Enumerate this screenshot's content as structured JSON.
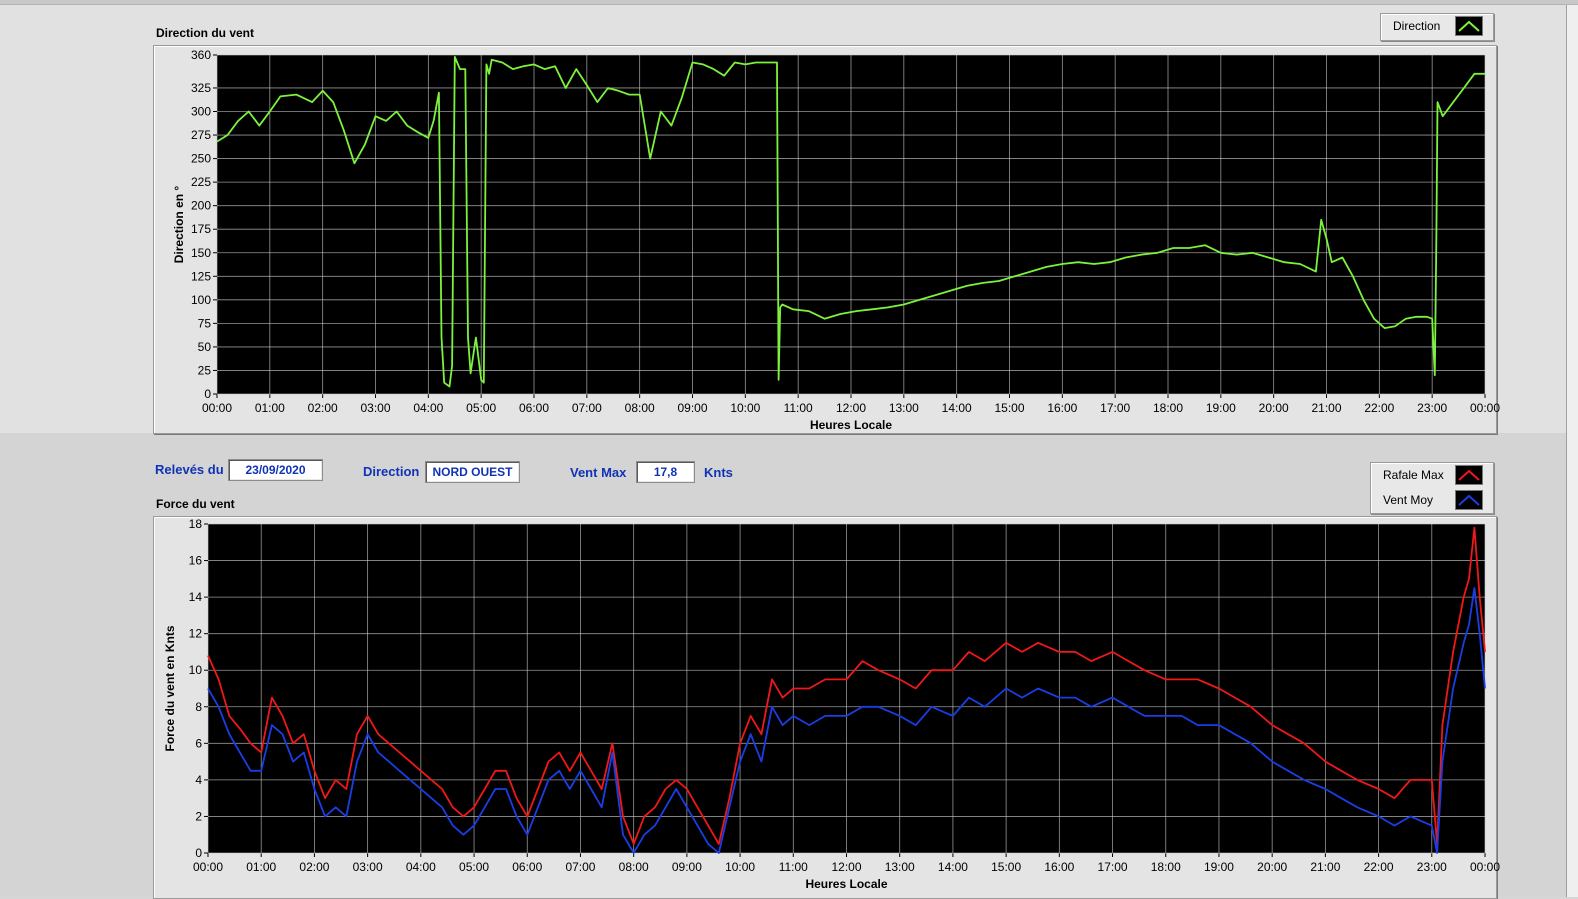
{
  "header": {
    "releves_label": "Relevés du",
    "releves_value": "23/09/2020",
    "direction_label": "Direction",
    "direction_value": "NORD OUEST",
    "ventmax_label": "Vent Max",
    "ventmax_value": "17,8",
    "ventmax_unit": "Knts"
  },
  "colors": {
    "direction_line": "#7cf23c",
    "rafale_line": "#f01818",
    "vent_line": "#1a3ee6",
    "plot_bg": "#000000",
    "grid": "#c8c8c8",
    "label_blue": "#1033b5"
  },
  "chart_data": [
    {
      "type": "line",
      "title": "Direction du vent",
      "xlabel": "Heures Locale",
      "ylabel": "Direction en °",
      "xlim": [
        0,
        24
      ],
      "ylim": [
        0,
        360
      ],
      "yticks": [
        0,
        25,
        50,
        75,
        100,
        125,
        150,
        175,
        200,
        225,
        250,
        275,
        300,
        325,
        360
      ],
      "xtick_labels": [
        "00:00",
        "01:00",
        "02:00",
        "03:00",
        "04:00",
        "05:00",
        "06:00",
        "07:00",
        "08:00",
        "09:00",
        "10:00",
        "11:00",
        "12:00",
        "13:00",
        "14:00",
        "15:00",
        "16:00",
        "17:00",
        "18:00",
        "19:00",
        "20:00",
        "21:00",
        "22:00",
        "23:00",
        "00:00"
      ],
      "grid": true,
      "legend_position": "top-right",
      "series": [
        {
          "name": "Direction",
          "color": "#7cf23c",
          "x": [
            0,
            0.2,
            0.4,
            0.6,
            0.8,
            1.0,
            1.2,
            1.5,
            1.8,
            2.0,
            2.2,
            2.4,
            2.6,
            2.8,
            3.0,
            3.2,
            3.4,
            3.6,
            3.8,
            4.0,
            4.1,
            4.2,
            4.25,
            4.3,
            4.4,
            4.45,
            4.5,
            4.6,
            4.7,
            4.75,
            4.8,
            4.9,
            5.0,
            5.05,
            5.1,
            5.15,
            5.2,
            5.4,
            5.6,
            5.8,
            6.0,
            6.2,
            6.4,
            6.6,
            6.8,
            7.0,
            7.2,
            7.4,
            7.6,
            7.8,
            8.0,
            8.2,
            8.4,
            8.6,
            8.8,
            9.0,
            9.2,
            9.4,
            9.6,
            9.8,
            10.0,
            10.2,
            10.4,
            10.6,
            10.63,
            10.66,
            10.7,
            10.9,
            11.2,
            11.5,
            11.8,
            12.1,
            12.4,
            12.7,
            13.0,
            13.3,
            13.6,
            13.9,
            14.2,
            14.5,
            14.8,
            15.1,
            15.4,
            15.7,
            16.0,
            16.3,
            16.6,
            16.9,
            17.2,
            17.5,
            17.8,
            18.1,
            18.4,
            18.7,
            19.0,
            19.3,
            19.6,
            19.9,
            20.2,
            20.5,
            20.8,
            20.9,
            21.0,
            21.1,
            21.3,
            21.5,
            21.7,
            21.9,
            22.1,
            22.3,
            22.5,
            22.7,
            22.9,
            23.0,
            23.05,
            23.08,
            23.1,
            23.2,
            23.4,
            23.6,
            23.8,
            24.0
          ],
          "y": [
            268,
            275,
            290,
            300,
            285,
            300,
            316,
            318,
            310,
            322,
            310,
            280,
            245,
            265,
            295,
            290,
            300,
            285,
            278,
            272,
            290,
            320,
            60,
            12,
            8,
            30,
            358,
            345,
            345,
            60,
            22,
            60,
            15,
            12,
            350,
            340,
            355,
            352,
            345,
            348,
            350,
            345,
            348,
            325,
            345,
            328,
            310,
            325,
            322,
            318,
            318,
            250,
            300,
            285,
            315,
            352,
            350,
            345,
            338,
            352,
            350,
            352,
            352,
            352,
            15,
            92,
            95,
            90,
            88,
            80,
            85,
            88,
            90,
            92,
            95,
            100,
            105,
            110,
            115,
            118,
            120,
            125,
            130,
            135,
            138,
            140,
            138,
            140,
            145,
            148,
            150,
            155,
            155,
            158,
            150,
            148,
            150,
            145,
            140,
            138,
            130,
            185,
            165,
            140,
            145,
            125,
            100,
            80,
            70,
            72,
            80,
            82,
            82,
            80,
            20,
            170,
            310,
            295,
            310,
            325,
            340,
            340
          ]
        }
      ]
    },
    {
      "type": "line",
      "title": "Force du vent",
      "xlabel": "Heures Locale",
      "ylabel": "Force du vent en Knts",
      "xlim": [
        0,
        24
      ],
      "ylim": [
        0,
        18
      ],
      "yticks": [
        0,
        2,
        4,
        6,
        8,
        10,
        12,
        14,
        16,
        18
      ],
      "xtick_labels": [
        "00:00",
        "01:00",
        "02:00",
        "03:00",
        "04:00",
        "05:00",
        "06:00",
        "07:00",
        "08:00",
        "09:00",
        "10:00",
        "11:00",
        "12:00",
        "13:00",
        "14:00",
        "15:00",
        "16:00",
        "17:00",
        "18:00",
        "19:00",
        "20:00",
        "21:00",
        "22:00",
        "23:00",
        "00:00"
      ],
      "grid": true,
      "legend_position": "top-right",
      "series": [
        {
          "name": "Rafale Max",
          "color": "#f01818",
          "x": [
            0,
            0.2,
            0.4,
            0.6,
            0.8,
            1.0,
            1.2,
            1.4,
            1.6,
            1.8,
            2.0,
            2.2,
            2.4,
            2.6,
            2.8,
            3.0,
            3.2,
            3.4,
            3.6,
            3.8,
            4.0,
            4.2,
            4.4,
            4.6,
            4.8,
            5.0,
            5.2,
            5.4,
            5.6,
            5.8,
            6.0,
            6.2,
            6.4,
            6.6,
            6.8,
            7.0,
            7.2,
            7.4,
            7.6,
            7.8,
            8.0,
            8.2,
            8.4,
            8.6,
            8.8,
            9.0,
            9.2,
            9.4,
            9.6,
            9.8,
            10.0,
            10.2,
            10.4,
            10.6,
            10.8,
            11.0,
            11.3,
            11.6,
            12.0,
            12.3,
            12.6,
            13.0,
            13.3,
            13.6,
            14.0,
            14.3,
            14.6,
            15.0,
            15.3,
            15.6,
            16.0,
            16.3,
            16.6,
            17.0,
            17.3,
            17.6,
            18.0,
            18.3,
            18.6,
            19.0,
            19.3,
            19.6,
            20.0,
            20.3,
            20.6,
            21.0,
            21.3,
            21.6,
            22.0,
            22.3,
            22.6,
            23.0,
            23.1,
            23.2,
            23.4,
            23.6,
            23.7,
            23.8,
            23.9,
            24.0
          ],
          "y": [
            10.8,
            9.5,
            7.5,
            6.8,
            6.0,
            5.5,
            8.5,
            7.5,
            6.0,
            6.5,
            4.5,
            3.0,
            4.0,
            3.5,
            6.5,
            7.5,
            6.5,
            6.0,
            5.5,
            5.0,
            4.5,
            4.0,
            3.5,
            2.5,
            2.0,
            2.5,
            3.5,
            4.5,
            4.5,
            3.0,
            2.0,
            3.5,
            5.0,
            5.5,
            4.5,
            5.5,
            4.5,
            3.5,
            6.0,
            2.0,
            0.5,
            2.0,
            2.5,
            3.5,
            4.0,
            3.5,
            2.5,
            1.5,
            0.5,
            3.0,
            6.0,
            7.5,
            6.5,
            9.5,
            8.5,
            9.0,
            9.0,
            9.5,
            9.5,
            10.5,
            10.0,
            9.5,
            9.0,
            10.0,
            10.0,
            11.0,
            10.5,
            11.5,
            11.0,
            11.5,
            11.0,
            11.0,
            10.5,
            11.0,
            10.5,
            10.0,
            9.5,
            9.5,
            9.5,
            9.0,
            8.5,
            8.0,
            7.0,
            6.5,
            6.0,
            5.0,
            4.5,
            4.0,
            3.5,
            3.0,
            4.0,
            4.0,
            0.5,
            7.0,
            11.0,
            14.0,
            15.0,
            17.8,
            14.0,
            11.0
          ]
        },
        {
          "name": "Vent Moy",
          "color": "#1a3ee6",
          "x": [
            0,
            0.2,
            0.4,
            0.6,
            0.8,
            1.0,
            1.2,
            1.4,
            1.6,
            1.8,
            2.0,
            2.2,
            2.4,
            2.6,
            2.8,
            3.0,
            3.2,
            3.4,
            3.6,
            3.8,
            4.0,
            4.2,
            4.4,
            4.6,
            4.8,
            5.0,
            5.2,
            5.4,
            5.6,
            5.8,
            6.0,
            6.2,
            6.4,
            6.6,
            6.8,
            7.0,
            7.2,
            7.4,
            7.6,
            7.8,
            8.0,
            8.2,
            8.4,
            8.6,
            8.8,
            9.0,
            9.2,
            9.4,
            9.6,
            9.8,
            10.0,
            10.2,
            10.4,
            10.6,
            10.8,
            11.0,
            11.3,
            11.6,
            12.0,
            12.3,
            12.6,
            13.0,
            13.3,
            13.6,
            14.0,
            14.3,
            14.6,
            15.0,
            15.3,
            15.6,
            16.0,
            16.3,
            16.6,
            17.0,
            17.3,
            17.6,
            18.0,
            18.3,
            18.6,
            19.0,
            19.3,
            19.6,
            20.0,
            20.3,
            20.6,
            21.0,
            21.3,
            21.6,
            22.0,
            22.3,
            22.6,
            23.0,
            23.1,
            23.2,
            23.4,
            23.6,
            23.7,
            23.8,
            23.9,
            24.0
          ],
          "y": [
            9.0,
            8.0,
            6.5,
            5.5,
            4.5,
            4.5,
            7.0,
            6.5,
            5.0,
            5.5,
            3.5,
            2.0,
            2.5,
            2.0,
            5.0,
            6.5,
            5.5,
            5.0,
            4.5,
            4.0,
            3.5,
            3.0,
            2.5,
            1.5,
            1.0,
            1.5,
            2.5,
            3.5,
            3.5,
            2.0,
            1.0,
            2.5,
            4.0,
            4.5,
            3.5,
            4.5,
            3.5,
            2.5,
            5.5,
            1.0,
            0.0,
            1.0,
            1.5,
            2.5,
            3.5,
            2.5,
            1.5,
            0.5,
            0.0,
            2.5,
            5.0,
            6.5,
            5.0,
            8.0,
            7.0,
            7.5,
            7.0,
            7.5,
            7.5,
            8.0,
            8.0,
            7.5,
            7.0,
            8.0,
            7.5,
            8.5,
            8.0,
            9.0,
            8.5,
            9.0,
            8.5,
            8.5,
            8.0,
            8.5,
            8.0,
            7.5,
            7.5,
            7.5,
            7.0,
            7.0,
            6.5,
            6.0,
            5.0,
            4.5,
            4.0,
            3.5,
            3.0,
            2.5,
            2.0,
            1.5,
            2.0,
            1.5,
            0.0,
            5.0,
            9.0,
            11.5,
            12.5,
            14.5,
            12.0,
            9.0
          ]
        }
      ]
    }
  ]
}
